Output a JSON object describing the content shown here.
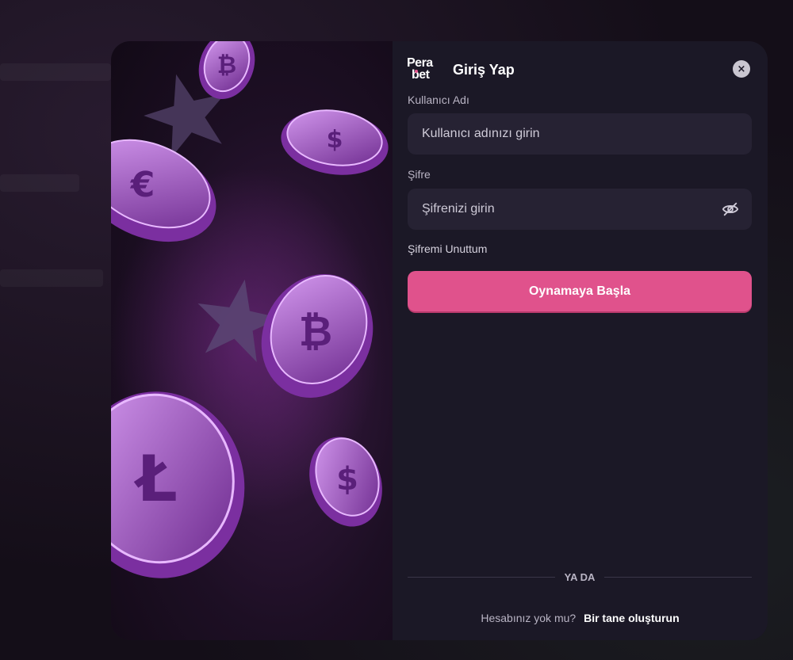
{
  "brand": {
    "logo_top": "Pera",
    "logo_bottom": "bet",
    "accent": "#e0528c"
  },
  "header": {
    "title": "Giriş Yap",
    "close_icon": "close-icon",
    "close_glyph": "×"
  },
  "form": {
    "username": {
      "label": "Kullanıcı Adı",
      "placeholder": "Kullanıcı adınızı girin",
      "value": ""
    },
    "password": {
      "label": "Şifre",
      "placeholder": "Şifrenizi girin",
      "value": "",
      "toggle_icon": "eye-slash-icon"
    },
    "forgot_label": "Şifremi Unuttum",
    "submit_label": "Oynamaya Başla"
  },
  "divider": {
    "text": "YA DA"
  },
  "signup": {
    "question": "Hesabınız yok mu?",
    "link_label": "Bir tane oluşturun"
  },
  "art": {
    "coins": [
      {
        "name": "bitcoin-coin-small",
        "symbol": "₿"
      },
      {
        "name": "dollar-coin-top",
        "symbol": "$"
      },
      {
        "name": "euro-coin",
        "symbol": "€"
      },
      {
        "name": "bitcoin-coin-large",
        "symbol": "₿"
      },
      {
        "name": "litecoin-coin",
        "symbol": "Ł"
      },
      {
        "name": "dollar-coin-bottom",
        "symbol": "$"
      }
    ],
    "coin_color": "#b14fd6"
  }
}
